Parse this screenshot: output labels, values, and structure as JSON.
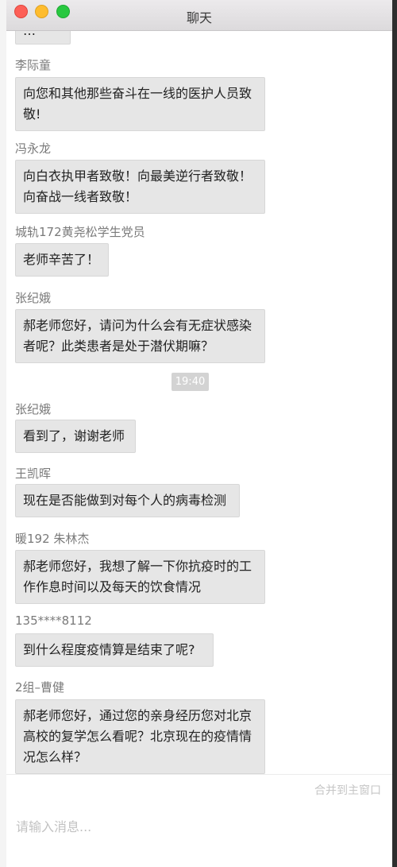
{
  "window": {
    "title": "聊天"
  },
  "messages": [
    {
      "sender": "",
      "text": "…"
    },
    {
      "sender": "李际童",
      "text": "向您和其他那些奋斗在一线的医护人员致敬!"
    },
    {
      "sender": "冯永龙",
      "text": "向白衣执甲者致敬！向最美逆行者致敬！向奋战一线者致敬！"
    },
    {
      "sender": "城轨172黄尧松学生党员",
      "text": "老师辛苦了！"
    },
    {
      "sender": "张纪娥",
      "text": "郝老师您好，请问为什么会有无症状感染者呢？此类患者是处于潜伏期嘛？"
    },
    {
      "sender": "张纪娥",
      "text": "看到了，谢谢老师"
    },
    {
      "sender": "王凯晖",
      "text": "现在是否能做到对每个人的病毒检测"
    },
    {
      "sender": "暖192 朱林杰",
      "text": "郝老师您好，我想了解一下你抗疫时的工作作息时间以及每天的饮食情况"
    },
    {
      "sender": "135****8112",
      "text": "到什么程度疫情算是结束了呢?"
    },
    {
      "sender": "2组–曹健",
      "text": "郝老师您好，通过您的亲身经历您对北京高校的复学怎么看呢？北京现在的疫情情况怎么样？"
    }
  ],
  "time_separator": "19:40",
  "input": {
    "merge_label": "合并到主窗口",
    "placeholder": "请输入消息..."
  },
  "colors": {
    "bubble_bg": "#e6e6e6",
    "sender_text": "#7a7a7a",
    "time_badge_bg": "#d3d3d3",
    "close_button": "#fd5f57",
    "minimize_button": "#febc2e",
    "maximize_button": "#28c840"
  }
}
